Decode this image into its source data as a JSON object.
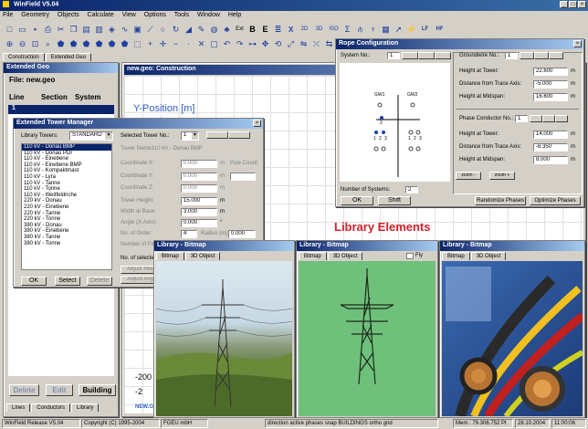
{
  "app": {
    "title": "WinField V5.04"
  },
  "menu": [
    "File",
    "Geometry",
    "Objects",
    "Calculate",
    "View",
    "Options",
    "Tools",
    "Window",
    "Help"
  ],
  "toolbar": {
    "ext_label": "Ext",
    "text_b": "B",
    "text_e": "E",
    "text_x": "X",
    "text_2d": "2D",
    "text_3d": "3D",
    "text_iso": "ISO",
    "text_lf": "LF",
    "text_hf": "HF"
  },
  "main_tabs": [
    "Construction",
    "Extended Geo"
  ],
  "left_panel": {
    "title": "Extended Geo",
    "file": "File: new.geo",
    "col_line": "Line",
    "col_section": "Section",
    "col_system": "System",
    "row_line": "1",
    "delete_label": "Delete",
    "edit_label": "Edit",
    "building_label": "Building",
    "tabs": [
      "Lines",
      "Conductors",
      "Library"
    ]
  },
  "construction": {
    "title": "new.geo: Construction",
    "axis_label": "Y-Position [m]",
    "tick_neg200": "-200",
    "tick_neg2": "-2",
    "footer": "NEW.GE"
  },
  "tower_manager": {
    "title": "Extended Tower Manager",
    "library_label": "Library Towers:",
    "library_value": "STANDARD",
    "towers": [
      "110 kV - Donau BMP",
      "110 kV - Donau PDI",
      "110 kV - Einebene",
      "110 kV - Einebene BMP",
      "110 kV - Kompaktmast",
      "110 kV - Lyra",
      "110 kV - Tanne",
      "110 kV - Tonne",
      "110 kV - Weitfeldriche",
      "220 kV - Donau",
      "220 kV - Einebene",
      "220 kV - Tanne",
      "220 kV - Tonne",
      "380 kV - Donau",
      "380 kV - Einebene",
      "380 kV - Tanne",
      "380 kV - Tonne"
    ],
    "selected_tower_label": "Selected Tower No.:",
    "selected_tower_value": "1",
    "tower_name_label": "Tower Name:",
    "tower_name_value": "110 kV - Donau BMP",
    "coord_x_label": "Coordinate X:",
    "coord_x_value": "0.000",
    "coord_y_label": "Coordinate Y:",
    "coord_y_value": "0.000",
    "coord_z_label": "Coordinate Z:",
    "coord_z_value": "0.000",
    "tower_height_label": "Tower Height:",
    "tower_height_value": "15.000",
    "width_base_label": "Width at Base:",
    "width_base_value": "3.000",
    "angle_label": "Angle (X-Axis):",
    "angle_value": "0.000",
    "no_order_label": "No. of Order:",
    "no_order_value": "4",
    "radius_label": "Radius [m]:",
    "radius_value": "0.000",
    "pole_count_label": "Pole Count:",
    "number_fields_label": "Number of Fields:",
    "no_selected_label": "No. of selected",
    "adjust_height_label": "Adjust Heigh",
    "adjust_angle_label": "Adjust Angle",
    "unit_m": "m",
    "unit_deg": "°",
    "ok_label": "OK",
    "select_label": "Select",
    "delete_label": "Delete"
  },
  "rope_config": {
    "title": "Rope Configuration",
    "system_no_label": "System No.:",
    "system_no_value": "1",
    "tower_labels": [
      "GW1",
      "GW2"
    ],
    "phase_labels": [
      "2",
      "1",
      "2",
      "3",
      "1",
      "2",
      "3"
    ],
    "number_systems_label": "Number of Systems:",
    "number_systems_value": "2",
    "ok_label": "OK",
    "shift_label": "Shift",
    "zoom_minus_label": "zoom -",
    "zoom_plus_label": "zoom +",
    "groundwire_label": "Groundwire No.:",
    "groundwire_value": "1",
    "gw_height_label": "Height at Tower:",
    "gw_height_value": "22.600",
    "gw_distance_label": "Distance from Trace Axis:",
    "gw_distance_value": "-5.000",
    "gw_midspan_label": "Height at Midspan:",
    "gw_midspan_value": "16.600",
    "phase_label": "Phase Conductor No.:",
    "phase_value": "1",
    "ph_height_label": "Height at Tower:",
    "ph_height_value": "14.000",
    "ph_distance_label": "Distance from Trace Axis:",
    "ph_distance_value": "-6.350",
    "ph_midspan_label": "Height at Midspan:",
    "ph_midspan_value": "8.000",
    "unit_m": "m",
    "randomize_label": "Randomize Phases",
    "optimize_label": "Optimize Phases"
  },
  "library_elements_label": "Library Elements",
  "bitmap1": {
    "title": "Library - Bitmap",
    "tabs": [
      "Bitmap",
      "3D Object"
    ]
  },
  "bitmap2": {
    "title": "Library - Bitmap",
    "tabs": [
      "Bitmap",
      "3D Object"
    ],
    "fly_label": "Fly"
  },
  "bitmap3": {
    "title": "Library - Bitmap",
    "tabs": [
      "Bitmap",
      "3D Object"
    ]
  },
  "status": {
    "release": "WinField Release V5.04",
    "copyright": "Copyright (C) 1995-2004",
    "company": "FGEU mbH",
    "modes": "direction active phases snap BUILDINGS ortho grid",
    "memory": "Mem.: 79.306.752 Pt",
    "date": "28.10.2004",
    "time": "11:00:06"
  }
}
